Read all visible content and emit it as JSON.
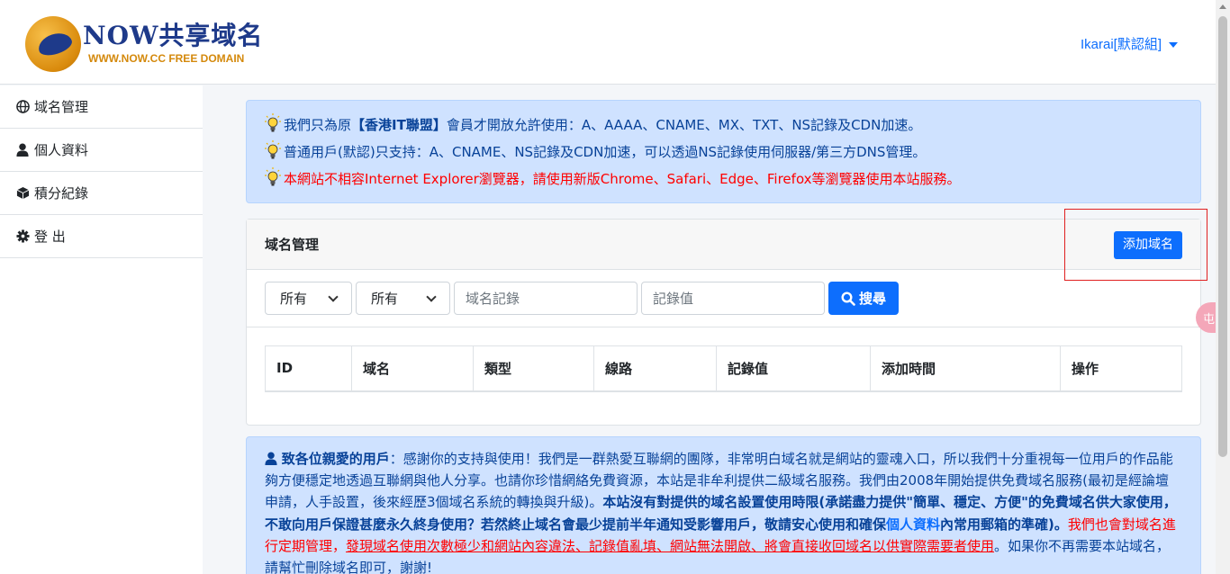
{
  "header": {
    "brand_title": "NOW共享域名",
    "brand_subtitle": "WWW.NOW.CC FREE DOMAIN",
    "user_menu": "Ikarai[默認組]"
  },
  "sidebar": {
    "items": [
      {
        "label": "域名管理",
        "icon": "globe-icon"
      },
      {
        "label": "個人資料",
        "icon": "user-icon"
      },
      {
        "label": "積分紀錄",
        "icon": "box-icon"
      },
      {
        "label": "登 出",
        "icon": "gear-icon"
      }
    ]
  },
  "notice": {
    "line1_prefix": "我們只為原",
    "line1_bold": "【香港IT聯盟】",
    "line1_suffix": "會員才開放允許使用：A、AAAA、CNAME、MX、TXT、NS記錄及CDN加速。",
    "line2": "普通用戶(默認)只支持：A、CNAME、NS記錄及CDN加速，可以透過NS記錄使用伺服器/第三方DNS管理。",
    "line3": "本網站不相容Internet Explorer瀏覽器，請使用新版Chrome、Safari、Edge、Firefox等瀏覽器使用本站服務。"
  },
  "card": {
    "title": "域名管理",
    "add_button": "添加域名",
    "filter": {
      "select1": "所有",
      "select2": "所有",
      "record_placeholder": "域名記錄",
      "value_placeholder": "記錄值",
      "search_button": "搜尋"
    },
    "table_headers": [
      "ID",
      "域名",
      "類型",
      "線路",
      "記錄值",
      "添加時間",
      "操作"
    ]
  },
  "info": {
    "heading": "致各位親愛的用戶",
    "p1": "：感謝你的支持與使用！我們是一群熱愛互聯網的團隊，非常明白域名就是網站的靈魂入口，所以我們十分重視每一位用戶的作品能夠方便穩定地透過互聯網與他人分享。也請你珍惜網絡免費資源，本站是非牟利提供二級域名服務。我們由2008年開始提供免費域名服務(最初是經論壇申請，人手設置，後來經歷3個域名系統的轉換與升級)。",
    "b1": "本站沒有對提供的域名設置使用時限(承諾盡力提供\"簡單、穩定、方便\"的免費域名供大家使用，不敢向用戶保證甚麼永久終身使用？若然終止域名會最少提前半年通知受影響用戶，敬請安心使用和確保",
    "link": "個人資料",
    "b2": "內常用郵箱的準確)。",
    "red1": "我們也會對域名進行定期管理，",
    "red2": "發現域名使用次數極少和網站內容違法、記錄值亂填、網站無法開啟、將會直接收回域名以供實際需要者使用",
    "tail": "。如果你不再需要本站域名，請幫忙刪除域名即可，謝謝!"
  },
  "float_tab": "屯"
}
